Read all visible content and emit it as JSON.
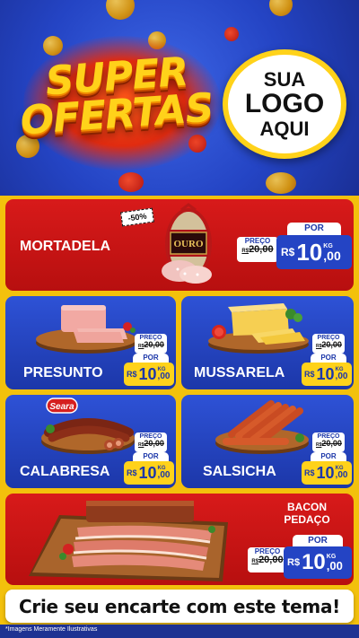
{
  "hero": {
    "title_line1": "SUPER",
    "title_line2": "OFERTAS",
    "logo_line1": "SUA",
    "logo_line2": "LOGO",
    "logo_line3": "AQUI"
  },
  "products": {
    "mortadela": {
      "name": "MORTADELA",
      "discount": "-50%",
      "brand": "OURO",
      "price_label": "PREÇO",
      "old_price": "20,00",
      "old_currency": "R$",
      "por_label": "POR",
      "currency": "R$",
      "price_int": "10",
      "price_cents": ",00",
      "unit": "KG"
    },
    "presunto": {
      "name": "PRESUNTO",
      "price_label": "PREÇO",
      "old_price": "20,00",
      "old_currency": "R$",
      "por_label": "POR",
      "currency": "R$",
      "price_int": "10",
      "price_cents": ",00",
      "unit": "KG"
    },
    "mussarela": {
      "name": "MUSSARELA",
      "price_label": "PREÇO",
      "old_price": "20,00",
      "old_currency": "R$",
      "por_label": "POR",
      "currency": "R$",
      "price_int": "10",
      "price_cents": ",00",
      "unit": "KG"
    },
    "calabresa": {
      "name": "CALABRESA",
      "brand": "Seara",
      "price_label": "PREÇO",
      "old_price": "20,00",
      "old_currency": "R$",
      "por_label": "POR",
      "currency": "R$",
      "price_int": "10",
      "price_cents": ",00",
      "unit": "KG"
    },
    "salsicha": {
      "name": "SALSICHA",
      "price_label": "PREÇO",
      "old_price": "20,00",
      "old_currency": "R$",
      "por_label": "POR",
      "currency": "R$",
      "price_int": "10",
      "price_cents": ",00",
      "unit": "KG"
    },
    "bacon": {
      "name_line1": "BACON",
      "name_line2": "PEDAÇO",
      "price_label": "PREÇO",
      "old_price": "20,00",
      "old_currency": "R$",
      "por_label": "POR",
      "currency": "R$",
      "price_int": "10",
      "price_cents": ",00",
      "unit": "KG"
    }
  },
  "cta": "Crie seu encarte com este tema!",
  "footer_note": "*Imagens Meramente Ilustrativas",
  "colors": {
    "red": "#c8161a",
    "blue": "#2444c4",
    "yellow": "#ffd21a",
    "background": "#f3c10c"
  }
}
